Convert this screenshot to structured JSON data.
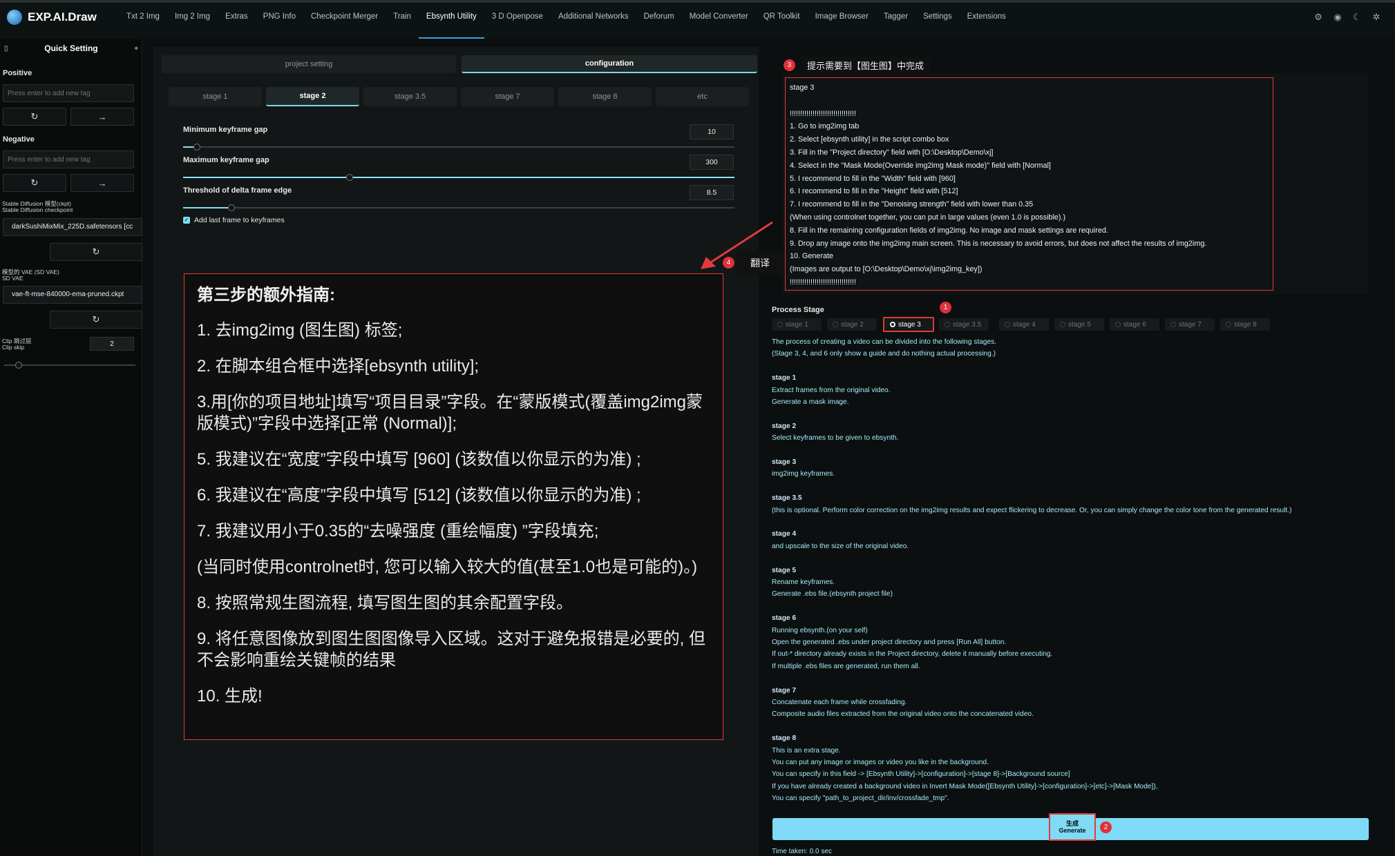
{
  "app": {
    "title": "EXP.AI.Draw"
  },
  "nav": {
    "items": [
      "Txt 2 Img",
      "Img 2 Img",
      "Extras",
      "PNG Info",
      "Checkpoint Merger",
      "Train",
      "Ebsynth Utility",
      "3 D Openpose",
      "Additional Networks",
      "Deforum",
      "Model Converter",
      "QR Toolkit",
      "Image Browser",
      "Tagger",
      "Settings",
      "Extensions"
    ],
    "active": "Ebsynth Utility"
  },
  "sidebar": {
    "title": "Quick Setting",
    "positive_label": "Positive",
    "positive_placeholder": "Press enter to add new tag",
    "negative_label": "Negative",
    "negative_placeholder": "Press enter to add new tag",
    "ckpt_label_1": "Stable Diffusion 模型(ckpt)",
    "ckpt_label_2": "Stable Diffusion checkpoint",
    "ckpt_value": "darkSushiMixMix_225D.safetensors [cc",
    "vae_label_1": "模型的 VAE (SD VAE)",
    "vae_label_2": "SD VAE",
    "vae_value": "vae-ft-mse-840000-ema-pruned.ckpt",
    "clip_label_1": "Clip 跳过层",
    "clip_label_2": "Clip skip",
    "clip_value": "2"
  },
  "main_tabs": {
    "project_setting": "project setting",
    "configuration": "configuration"
  },
  "stage_tabs": [
    "stage 1",
    "stage 2",
    "stage 3.5",
    "stage 7",
    "stage 8",
    "etc"
  ],
  "settings": {
    "min_gap_label": "Minimum keyframe gap",
    "min_gap_value": "10",
    "max_gap_label": "Maximum keyframe gap",
    "max_gap_value": "300",
    "threshold_label": "Threshold of delta frame edge",
    "threshold_value": "8.5",
    "add_last_label": "Add last frame to keyframes"
  },
  "annotations": {
    "note3": "提示需要到【图生图】中完成",
    "note4": "翻译",
    "n1": "1",
    "n2": "2",
    "n3": "3",
    "n4": "4"
  },
  "guide": [
    "stage 3",
    "",
    "!!!!!!!!!!!!!!!!!!!!!!!!!!!!!!!!",
    "1. Go to img2img tab",
    "2. Select [ebsynth utility] in the script combo box",
    "3. Fill in the \"Project directory\" field with [O:\\Desktop\\Demo\\xj]",
    "4. Select in the \"Mask Mode(Override img2img Mask mode)\" field with [Normal]",
    "5. I recommend to fill in the \"Width\" field with [960]",
    "6. I recommend to fill in the \"Height\" field with [512]",
    "7. I recommend to fill in the \"Denoising strength\" field with lower than 0.35",
    "(When using controlnet together, you can put in large values (even 1.0 is possible).)",
    "8. Fill in the remaining configuration fields of img2img. No image and mask settings are required.",
    "9. Drop any image onto the img2img main screen. This is necessary to avoid errors, but does not affect the results of img2img.",
    "10. Generate",
    "(Images are output to [O:\\Desktop\\Demo\\xj\\img2img_key])",
    "!!!!!!!!!!!!!!!!!!!!!!!!!!!!!!!!"
  ],
  "translation": {
    "title": "第三步的额外指南:",
    "lines": [
      "1. 去img2img (图生图) 标签;",
      "2. 在脚本组合框中选择[ebsynth utility];",
      "3.用[你的项目地址]填写“项目目录”字段。在“蒙版模式(覆盖img2img蒙版模式)”字段中选择[正常 (Normal)];",
      "5. 我建议在“宽度”字段中填写 [960] (该数值以你显示的为准) ;",
      "6. 我建议在“高度”字段中填写 [512] (该数值以你显示的为准) ;",
      "7. 我建议用小于0.35的“去噪强度 (重绘幅度) ”字段填充;",
      "(当同时使用controlnet时, 您可以输入较大的值(甚至1.0也是可能的)。)",
      "8. 按照常规生图流程, 填写图生图的其余配置字段。",
      "9. 将任意图像放到图生图图像导入区域。这对于避免报错是必要的, 但不会影响重绘关键帧的结果",
      "10. 生成!"
    ]
  },
  "process_stage": {
    "label": "Process Stage",
    "options": [
      "stage 1",
      "stage 2",
      "stage 3",
      "stage 3.5",
      "stage 4",
      "stage 5",
      "stage 6",
      "stage 7",
      "stage 8"
    ],
    "selected": "stage 3"
  },
  "description": [
    {
      "t": "The process of creating a video can be divided into the following stages.",
      "h": false
    },
    {
      "t": "(Stage 3, 4, and 6 only show a guide and do nothing actual processing.)",
      "h": false
    },
    {
      "t": "",
      "h": false
    },
    {
      "t": "stage 1",
      "h": true
    },
    {
      "t": "Extract frames from the original video.",
      "h": false
    },
    {
      "t": "Generate a mask image.",
      "h": false
    },
    {
      "t": "",
      "h": false
    },
    {
      "t": "stage 2",
      "h": true
    },
    {
      "t": "Select keyframes to be given to ebsynth.",
      "h": false
    },
    {
      "t": "",
      "h": false
    },
    {
      "t": "stage 3",
      "h": true
    },
    {
      "t": "img2img keyframes.",
      "h": false
    },
    {
      "t": "",
      "h": false
    },
    {
      "t": "stage 3.5",
      "h": true
    },
    {
      "t": "(this is optional. Perform color correction on the img2img results and expect flickering to decrease. Or, you can simply change the color tone from the generated result.)",
      "h": false
    },
    {
      "t": "",
      "h": false
    },
    {
      "t": "stage 4",
      "h": true
    },
    {
      "t": "and upscale to the size of the original video.",
      "h": false
    },
    {
      "t": "",
      "h": false
    },
    {
      "t": "stage 5",
      "h": true
    },
    {
      "t": "Rename keyframes.",
      "h": false
    },
    {
      "t": "Generate .ebs file.(ebsynth project file)",
      "h": false
    },
    {
      "t": "",
      "h": false
    },
    {
      "t": "stage 6",
      "h": true
    },
    {
      "t": "Running ebsynth.(on your self)",
      "h": false
    },
    {
      "t": "Open the generated .ebs under project directory and press [Run All] button.",
      "h": false
    },
    {
      "t": "If out-* directory already exists in the Project directory, delete it manually before executing.",
      "h": false
    },
    {
      "t": "If multiple .ebs files are generated, run them all.",
      "h": false
    },
    {
      "t": "",
      "h": false
    },
    {
      "t": "stage 7",
      "h": true
    },
    {
      "t": "Concatenate each frame while crossfading.",
      "h": false
    },
    {
      "t": "Composite audio files extracted from the original video onto the concatenated video.",
      "h": false
    },
    {
      "t": "",
      "h": false
    },
    {
      "t": "stage 8",
      "h": true
    },
    {
      "t": "This is an extra stage.",
      "h": false
    },
    {
      "t": "You can put any image or images or video you like in the background.",
      "h": false
    },
    {
      "t": "You can specify in this field -> [Ebsynth Utility]->[configuration]->[stage 8]->[Background source]",
      "h": false
    },
    {
      "t": "If you have already created a background video in Invert Mask Mode([Ebsynth Utility]->[configuration]->[etc]->[Mask Mode]),",
      "h": false
    },
    {
      "t": "You can specify \"path_to_project_dir/inv/crossfade_tmp\".",
      "h": false
    }
  ],
  "generate": {
    "label_cn": "生成",
    "label_en": "Generate"
  },
  "time_taken": "Time taken: 0.0 sec",
  "colors": {
    "accent": "#7fdaf5",
    "highlight": "#e03b3b"
  }
}
